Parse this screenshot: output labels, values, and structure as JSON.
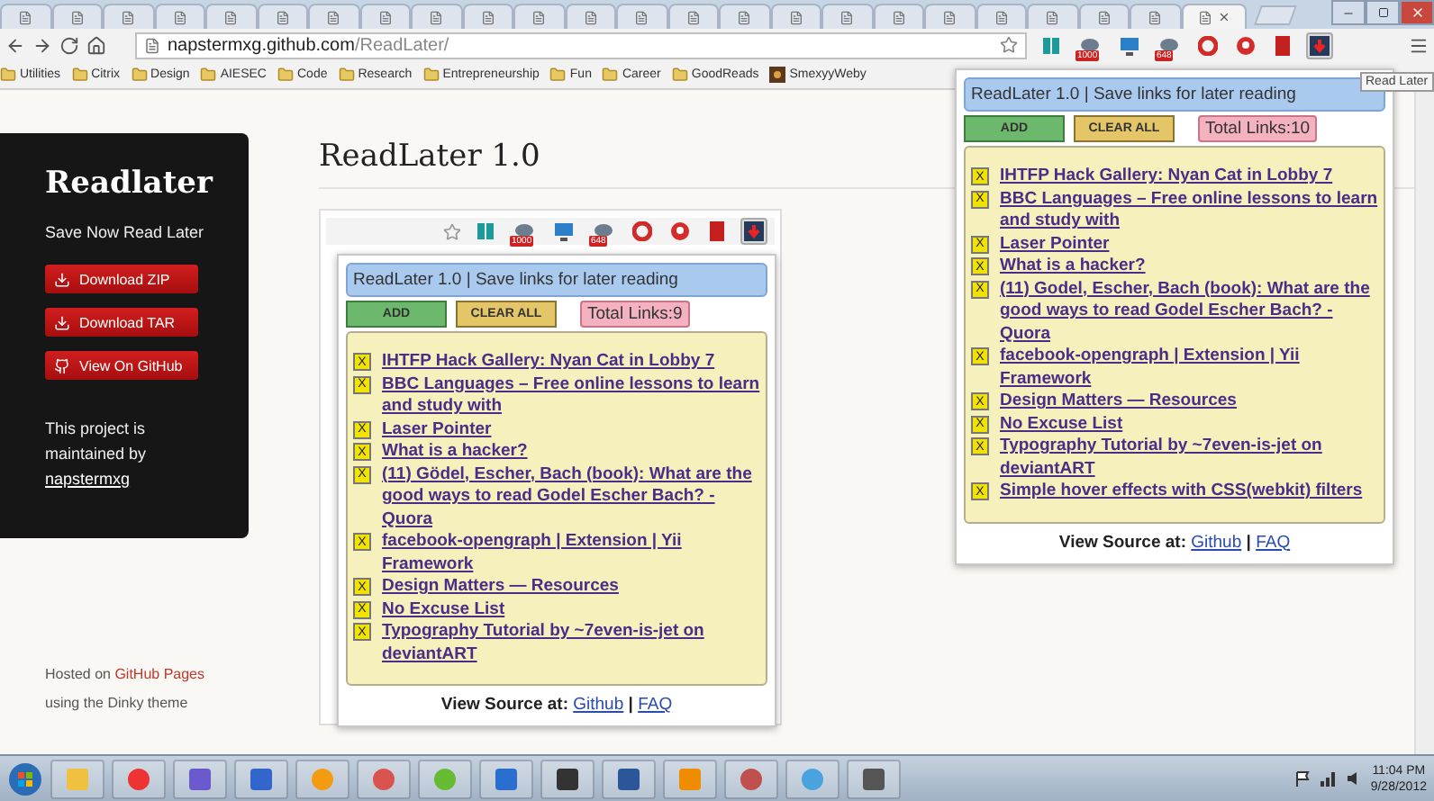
{
  "browser": {
    "tabs": [
      {
        "selected": false
      },
      {
        "selected": false
      },
      {
        "selected": false
      },
      {
        "selected": false
      },
      {
        "selected": false
      },
      {
        "selected": false
      },
      {
        "selected": false
      },
      {
        "selected": false
      },
      {
        "selected": false
      },
      {
        "selected": false
      },
      {
        "selected": false
      },
      {
        "selected": false
      },
      {
        "selected": false
      },
      {
        "selected": false
      },
      {
        "selected": false
      },
      {
        "selected": false
      },
      {
        "selected": false
      },
      {
        "selected": false
      },
      {
        "selected": false
      },
      {
        "selected": false
      },
      {
        "selected": false
      },
      {
        "selected": false
      },
      {
        "selected": false
      },
      {
        "selected": true
      }
    ],
    "address": {
      "domain": "napstermxg.github.com",
      "path": "/ReadLater/"
    },
    "extensions": [
      {
        "kind": "book"
      },
      {
        "kind": "counter",
        "badge": "1000"
      },
      {
        "kind": "monitor"
      },
      {
        "kind": "counter",
        "badge": "648"
      },
      {
        "kind": "ring"
      },
      {
        "kind": "flower"
      },
      {
        "kind": "bookmark"
      },
      {
        "kind": "readlater",
        "selected": true
      }
    ],
    "bookmarks": [
      {
        "kind": "folder",
        "label": "Utilities"
      },
      {
        "kind": "folder",
        "label": "Citrix"
      },
      {
        "kind": "folder",
        "label": "Design"
      },
      {
        "kind": "folder",
        "label": "AIESEC"
      },
      {
        "kind": "folder",
        "label": "Code"
      },
      {
        "kind": "folder",
        "label": "Research"
      },
      {
        "kind": "folder",
        "label": "Entrepreneurship"
      },
      {
        "kind": "folder",
        "label": "Fun"
      },
      {
        "kind": "folder",
        "label": "Career"
      },
      {
        "kind": "folder",
        "label": "GoodReads"
      },
      {
        "kind": "site",
        "label": "SmexyyWeby"
      }
    ],
    "tooltip": "Read Later"
  },
  "sidebar": {
    "title": "Readlater",
    "tagline": "Save Now Read Later",
    "buttons": [
      {
        "kind": "download",
        "label": "Download ZIP"
      },
      {
        "kind": "download",
        "label": "Download TAR"
      },
      {
        "kind": "github",
        "label": "View On GitHub"
      }
    ],
    "maintained": {
      "text": "This project is maintained by",
      "link": "napstermxg"
    },
    "hosted": {
      "before": "Hosted on",
      "link": "GitHub Pages",
      "after": "using the Dinky theme"
    }
  },
  "main": {
    "heading": "ReadLater 1.0",
    "screenshot": {
      "extensions": [
        {
          "kind": "book"
        },
        {
          "kind": "counter",
          "badge": "1000"
        },
        {
          "kind": "monitor"
        },
        {
          "kind": "counter",
          "badge": "648"
        },
        {
          "kind": "ring"
        },
        {
          "kind": "flower"
        },
        {
          "kind": "bookmark"
        },
        {
          "kind": "readlater",
          "selected": true
        }
      ],
      "popup": {
        "title": "ReadLater 1.0 | Save links for later reading",
        "add": "ADD",
        "clear": "CLEAR ALL",
        "total": "Total Links:9",
        "links": [
          {
            "remove": "X",
            "title": "IHTFP Hack Gallery: Nyan Cat in Lobby 7"
          },
          {
            "remove": "X",
            "title": "BBC Languages – Free online lessons to learn and study with"
          },
          {
            "remove": "X",
            "title": "Laser Pointer"
          },
          {
            "remove": "X",
            "title": "What is a hacker?"
          },
          {
            "remove": "X",
            "title": "(11) Gödel, Escher, Bach (book): What are the good ways to read Godel Escher Bach? - Quora"
          },
          {
            "remove": "X",
            "title": "facebook-opengraph | Extension | Yii Framework"
          },
          {
            "remove": "X",
            "title": "Design Matters — Resources"
          },
          {
            "remove": "X",
            "title": "No Excuse List"
          },
          {
            "remove": "X",
            "title": "Typography Tutorial by ~7even-is-jet on deviantART"
          }
        ],
        "footer": {
          "label": "View Source at:",
          "links": [
            "Github",
            "FAQ"
          ],
          "separator": "|"
        }
      }
    }
  },
  "extension_popup": {
    "title": "ReadLater 1.0 | Save links for later reading",
    "add": "ADD",
    "clear": "CLEAR ALL",
    "total": "Total Links:10",
    "links": [
      {
        "remove": "X",
        "title": "IHTFP Hack Gallery: Nyan Cat in Lobby 7"
      },
      {
        "remove": "X",
        "title": "BBC Languages – Free online lessons to learn and study with"
      },
      {
        "remove": "X",
        "title": "Laser Pointer"
      },
      {
        "remove": "X",
        "title": "What is a hacker?"
      },
      {
        "remove": "X",
        "title": "(11) Godel, Escher, Bach (book): What are the good ways to read Godel Escher Bach? - Quora"
      },
      {
        "remove": "X",
        "title": "facebook-opengraph | Extension | Yii Framework"
      },
      {
        "remove": "X",
        "title": "Design Matters — Resources"
      },
      {
        "remove": "X",
        "title": "No Excuse List"
      },
      {
        "remove": "X",
        "title": "Typography Tutorial by ~7even-is-jet on deviantART"
      },
      {
        "remove": "X",
        "title": "Simple hover effects with CSS(webkit) filters"
      }
    ],
    "footer": {
      "label": "View Source at:",
      "links": [
        "Github",
        "FAQ"
      ],
      "separator": "|"
    }
  },
  "taskbar": {
    "time": "11:04 PM",
    "date": "9/28/2012"
  }
}
